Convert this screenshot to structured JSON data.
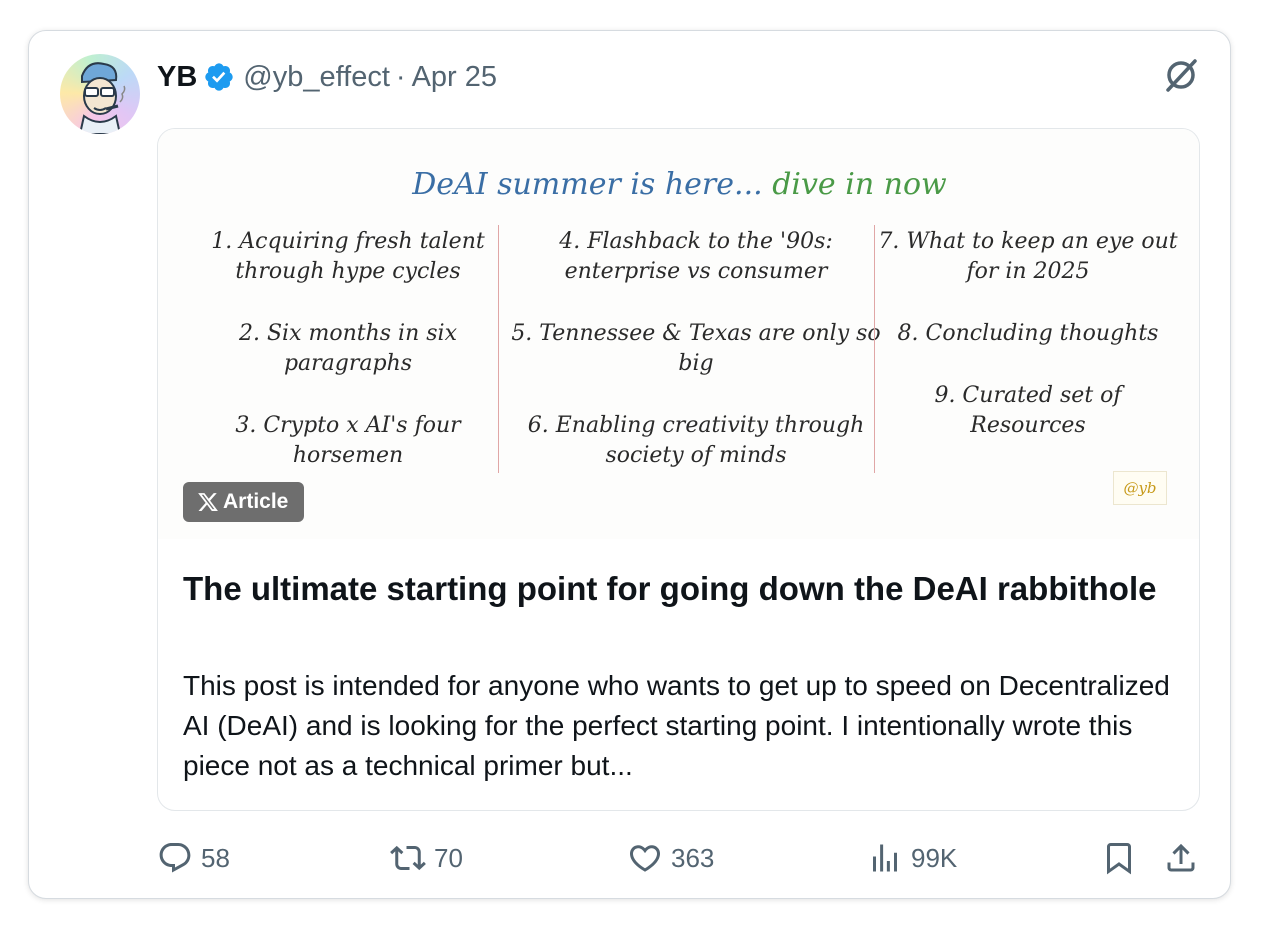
{
  "tweet": {
    "author_name": "YB",
    "handle": "@yb_effect",
    "separator": "·",
    "date": "Apr 25",
    "icons": {
      "verified": "verified-badge-icon",
      "grok": "grok-icon"
    },
    "accent_color": "#1d9bf0"
  },
  "article": {
    "thumbnail": {
      "title_part1": "DeAI summer is here...",
      "title_part2": "dive in now",
      "items_col1": [
        "1. Acquiring fresh talent through hype cycles",
        "2. Six months in six paragraphs",
        "3. Crypto x AI's four horsemen"
      ],
      "items_col2": [
        "4. Flashback to the '90s: enterprise vs consumer",
        "5. Tennessee & Texas are only so big",
        "6. Enabling creativity through society of minds"
      ],
      "items_col3": [
        "7. What to keep an eye out for in 2025",
        "8. Concluding thoughts",
        "9. Curated set of Resources"
      ],
      "stamp": "@yb"
    },
    "badge_label": "Article",
    "title": "The ultimate starting point for going down the DeAI rabbithole",
    "description": "This post is intended for anyone who wants to get up to speed on Decentralized AI (DeAI) and is looking for the perfect starting point. I intentionally wrote this piece not as a technical primer but..."
  },
  "actions": {
    "replies": "58",
    "reposts": "70",
    "likes": "363",
    "views": "99K"
  }
}
